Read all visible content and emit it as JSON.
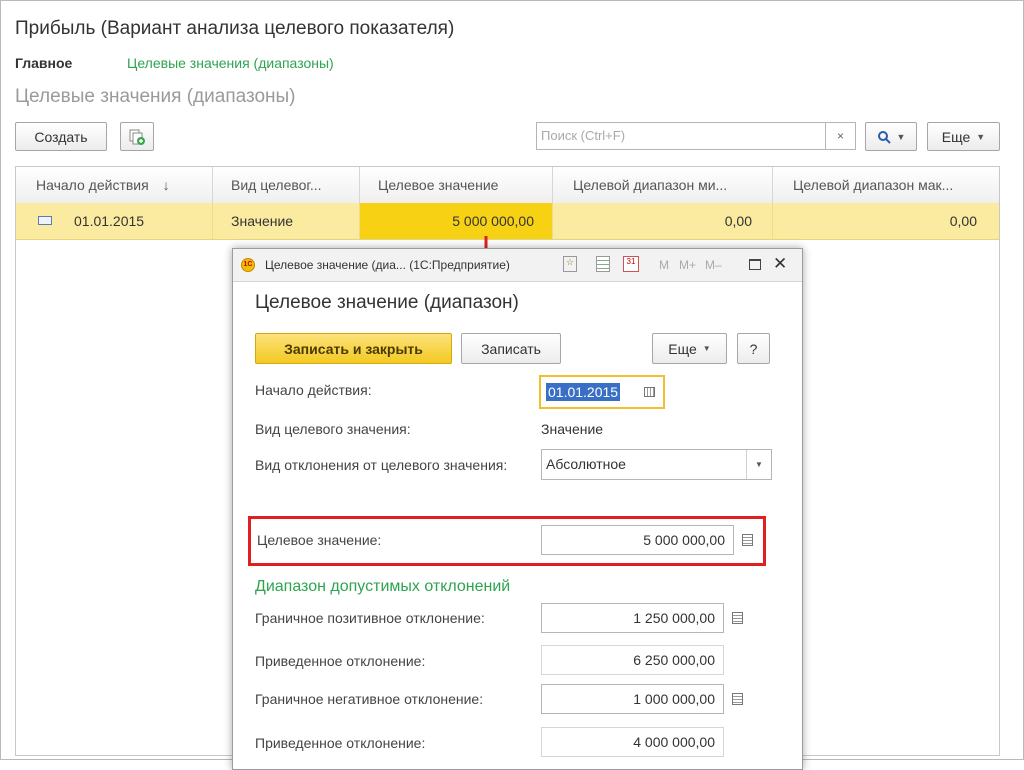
{
  "page": {
    "title": "Прибыль (Вариант анализа целевого показателя)",
    "nav_main": "Главное",
    "nav_link": "Целевые значения (диапазоны)",
    "section_title": "Целевые значения (диапазоны)"
  },
  "toolbar": {
    "create_label": "Создать",
    "search_placeholder": "Поиск (Ctrl+F)",
    "clear_label": "×",
    "more_label": "Еще"
  },
  "table": {
    "columns": [
      "Начало действия",
      "Вид целевог...",
      "Целевое значение",
      "Целевой диапазон ми...",
      "Целевой диапазон мак..."
    ],
    "sort_indicator": "↓",
    "rows": [
      {
        "date": "01.01.2015",
        "type": "Значение",
        "target": "5 000 000,00",
        "min": "0,00",
        "max": "0,00"
      }
    ]
  },
  "dialog": {
    "window_title": "Целевое значение (диа... (1С:Предприятие)",
    "tb_m": "M",
    "tb_mplus": "M+",
    "tb_mminus": "M–",
    "heading": "Целевое значение (диапазон)",
    "save_close_label": "Записать и закрыть",
    "save_label": "Записать",
    "more_label": "Еще",
    "help_label": "?",
    "start_label": "Начало действия:",
    "start_value": "01.01.2015",
    "kind_label": "Вид целевого значения:",
    "kind_value": "Значение",
    "deviation_label": "Вид отклонения от целевого значения:",
    "deviation_value": "Абсолютное",
    "target_label": "Целевое значение:",
    "target_value": "5 000 000,00",
    "range_heading": "Диапазон допустимых отклонений",
    "pos_label": "Граничное позитивное отклонение:",
    "pos_value": "1 250 000,00",
    "red1_label": "Приведенное отклонение:",
    "red1_value": "6 250 000,00",
    "neg_label": "Граничное негативное отклонение:",
    "neg_value": "1 000 000,00",
    "red2_label": "Приведенное отклонение:",
    "red2_value": "4 000 000,00"
  },
  "colors": {
    "accent_yellow": "#fbeba0",
    "highlight_red": "#e02020",
    "link_green": "#2ea44f",
    "primary_button": "#f7d23a"
  }
}
